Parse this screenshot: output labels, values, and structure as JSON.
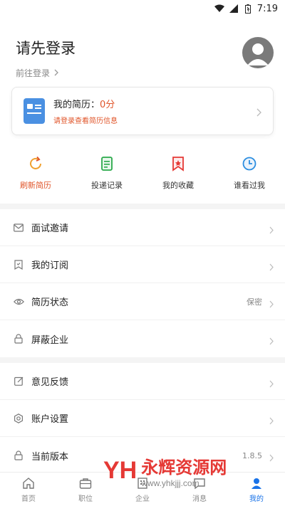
{
  "status_bar": {
    "time": "7:19"
  },
  "header": {
    "title": "请先登录",
    "login_link": "前往登录"
  },
  "resume_card": {
    "title_prefix": "我的简历：",
    "score": "0分",
    "hint": "请登录查看简历信息"
  },
  "actions": [
    {
      "label": "刷新简历",
      "icon": "refresh-icon",
      "color": "#e0552a"
    },
    {
      "label": "投递记录",
      "icon": "document-icon",
      "color": "#2aa94a"
    },
    {
      "label": "我的收藏",
      "icon": "bookmark-icon",
      "color": "#e53935"
    },
    {
      "label": "谁看过我",
      "icon": "clock-icon",
      "color": "#2b8de0"
    }
  ],
  "menu_group1": [
    {
      "label": "面试邀请",
      "icon": "mail-icon",
      "value": ""
    },
    {
      "label": "我的订阅",
      "icon": "subscribe-icon",
      "value": ""
    },
    {
      "label": "简历状态",
      "icon": "eye-icon",
      "value": "保密"
    },
    {
      "label": "屏蔽企业",
      "icon": "lock-icon",
      "value": ""
    }
  ],
  "menu_group2": [
    {
      "label": "意见反馈",
      "icon": "edit-icon",
      "value": ""
    },
    {
      "label": "账户设置",
      "icon": "gear-icon",
      "value": ""
    },
    {
      "label": "当前版本",
      "icon": "lock-icon",
      "value": "1.8.5"
    }
  ],
  "tabs": [
    {
      "label": "首页",
      "icon": "home-icon"
    },
    {
      "label": "职位",
      "icon": "briefcase-icon"
    },
    {
      "label": "企业",
      "icon": "building-icon"
    },
    {
      "label": "消息",
      "icon": "message-icon"
    },
    {
      "label": "我的",
      "icon": "person-icon"
    }
  ],
  "watermark": {
    "logo": "YH",
    "cn": "永辉资源网",
    "url": "www.yhkjjj.com"
  }
}
